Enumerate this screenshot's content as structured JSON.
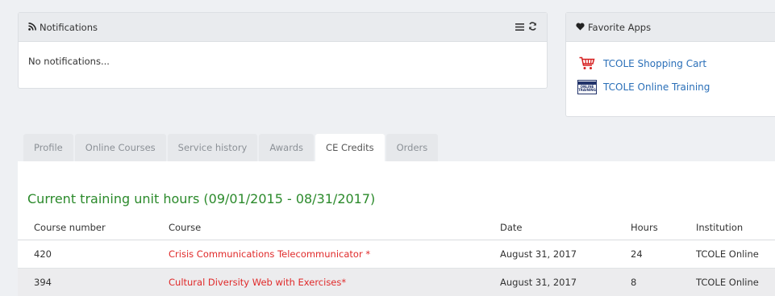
{
  "notifications": {
    "title": "Notifications",
    "empty_text": "No notifications..."
  },
  "favorites": {
    "title": "Favorite Apps",
    "apps": [
      {
        "label": "TCOLE Shopping Cart",
        "icon": "shopping-cart-icon"
      },
      {
        "label": "TCOLE Online Training",
        "icon": "tcole-online-training-logo",
        "logo_line1": "ONLINE",
        "logo_line2": "TRAINING"
      }
    ]
  },
  "tabs": [
    {
      "label": "Profile",
      "active": false
    },
    {
      "label": "Online Courses",
      "active": false
    },
    {
      "label": "Service history",
      "active": false
    },
    {
      "label": "Awards",
      "active": false
    },
    {
      "label": "CE Credits",
      "active": true
    },
    {
      "label": "Orders",
      "active": false
    }
  ],
  "credits": {
    "title": "Current training unit hours (09/01/2015 - 08/31/2017)",
    "columns": [
      "Course number",
      "Course",
      "Date",
      "Hours",
      "Institution"
    ],
    "rows": [
      {
        "number": "420",
        "course": "Crisis Communications Telecommunicator *",
        "date": "August 31, 2017",
        "hours": "24",
        "institution": "TCOLE Online"
      },
      {
        "number": "394",
        "course": "Cultural Diversity Web with Exercises*",
        "date": "August 31, 2017",
        "hours": "8",
        "institution": "TCOLE Online"
      }
    ]
  },
  "colors": {
    "section_title": "#2b8a2b",
    "course_link": "#e02a2a",
    "app_link": "#2a6fb8"
  }
}
